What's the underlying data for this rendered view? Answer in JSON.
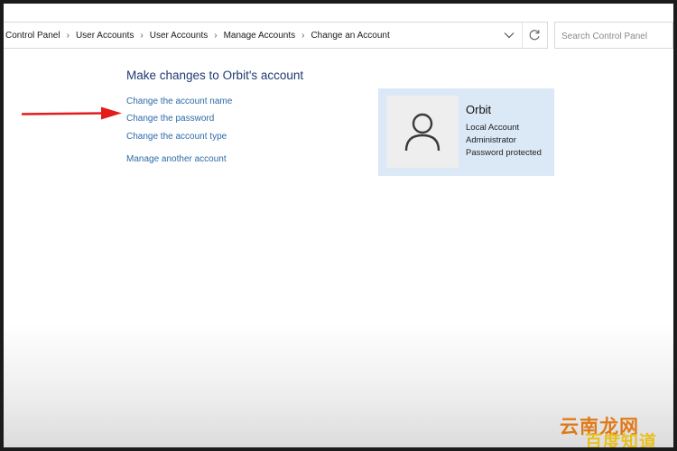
{
  "breadcrumb": {
    "items": [
      "Control Panel",
      "User Accounts",
      "User Accounts",
      "Manage Accounts",
      "Change an Account"
    ]
  },
  "search": {
    "placeholder": "Search Control Panel"
  },
  "main": {
    "title": "Make changes to Orbit's account",
    "links": {
      "change_name": "Change the account name",
      "change_password": "Change the password",
      "change_type": "Change the account type",
      "manage_another": "Manage another account"
    }
  },
  "account_card": {
    "name": "Orbit",
    "type": "Local Account",
    "role": "Administrator",
    "status": "Password protected"
  },
  "icons": {
    "address_dropdown": "chevron-down-icon",
    "refresh": "refresh-icon",
    "avatar": "user-icon",
    "annotation": "red-arrow-icon"
  },
  "colors": {
    "link": "#2d6aa8",
    "heading": "#1f3b72",
    "card_background": "#dbe8f6",
    "annotation_arrow": "#e31b1b"
  },
  "watermark": {
    "top": "云南龙网",
    "bottom": "百度知道"
  }
}
